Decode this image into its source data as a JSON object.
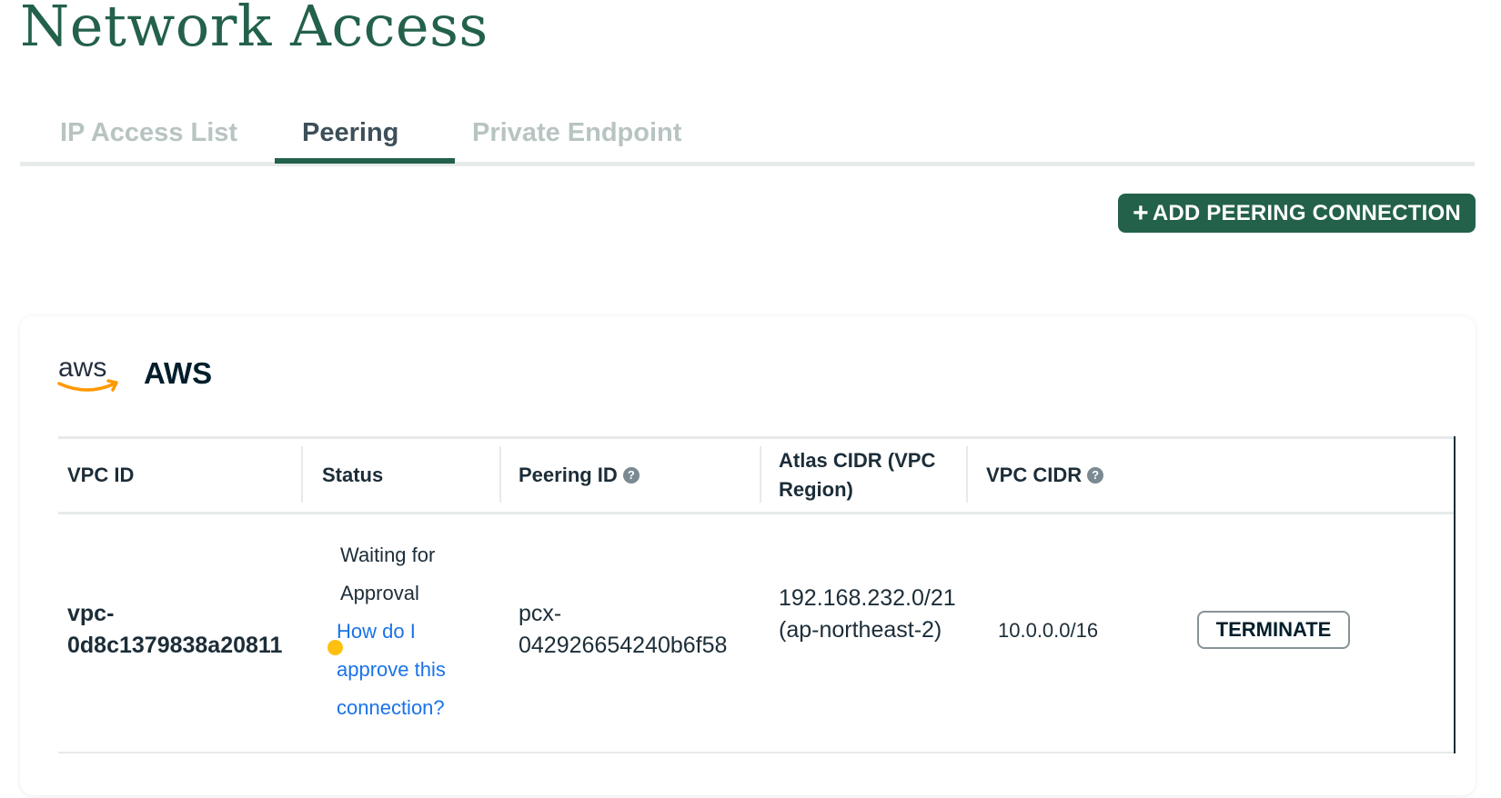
{
  "page": {
    "title": "Network Access"
  },
  "tabs": [
    {
      "label": "IP Access List",
      "active": false
    },
    {
      "label": "Peering",
      "active": true
    },
    {
      "label": "Private Endpoint",
      "active": false
    }
  ],
  "toolbar": {
    "add_label": "ADD PEERING CONNECTION",
    "add_icon": "plus-icon"
  },
  "provider": {
    "name": "AWS",
    "logo_text": "aws",
    "logo_arrow_color": "#ff9900"
  },
  "table": {
    "headers": {
      "vpc_id": "VPC ID",
      "status": "Status",
      "peering_id": "Peering ID",
      "atlas_cidr": "Atlas CIDR (VPC Region)",
      "vpc_cidr": "VPC CIDR"
    },
    "rows": [
      {
        "vpc_id": "vpc-0d8c1379838a20811",
        "status": "Waiting for Approval",
        "status_color": "#ffc010",
        "status_link": "How do I approve this connection?",
        "peering_id": "pcx-042926654240b6f58",
        "atlas_cidr": "192.168.232.0/21 (ap-northeast-2)",
        "vpc_cidr": "10.0.0.0/16",
        "action": "TERMINATE"
      }
    ]
  },
  "colors": {
    "brand": "#23614a",
    "link": "#1a73e8",
    "text": "#1c2d38"
  }
}
